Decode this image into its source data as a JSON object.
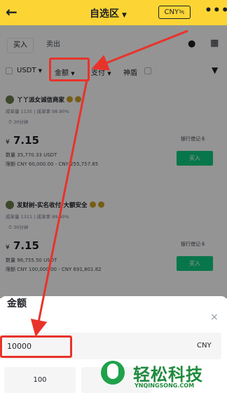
{
  "header": {
    "back_glyph": "←",
    "title": "自选区",
    "title_caret": "▼",
    "currency_button": "CNY≒",
    "more_glyph": "•••"
  },
  "tabs": {
    "buy": "买入",
    "sell": "卖出"
  },
  "filters": {
    "asset": "USDT",
    "amount": "金额",
    "payment": "支付",
    "shield": "神盾",
    "caret": "▼"
  },
  "listings": [
    {
      "merchant": "丫丫派女诚信商家",
      "orders_label": "成单量",
      "orders": "1135",
      "rate_label": "成单率",
      "rate": "98.90%",
      "time": "30分钟",
      "currency_symbol": "¥",
      "price": "7.15",
      "quantity_label": "数量",
      "quantity": "35,770.33 USDT",
      "limit_label": "限额",
      "limit": "CNY 60,000.00 - CNY 255,757.85",
      "payment": "银行借记卡",
      "action": "买入"
    },
    {
      "merchant": "发财树-实名收付-大额安全",
      "orders_label": "成单量",
      "orders": "1311",
      "rate_label": "成单率",
      "rate": "99.40%",
      "time": "30分钟",
      "currency_symbol": "¥",
      "price": "7.15",
      "quantity_label": "数量",
      "quantity": "96,755.50 USDT",
      "limit_label": "限额",
      "limit": "CNY 100,000.00 - CNY 691,801.82",
      "payment": "银行借记卡",
      "action": "买入"
    }
  ],
  "sheet": {
    "title": "金额",
    "close_glyph": "×",
    "amount_value": "10000",
    "amount_unit": "CNY",
    "quick_amounts": [
      "100"
    ]
  },
  "watermark": {
    "name": "轻松科技",
    "domain": "YNQINGSONG.COM"
  },
  "colors": {
    "brand_yellow": "#fcd535",
    "buy_green": "#0ecb81",
    "annotation_red": "#e8332a"
  }
}
